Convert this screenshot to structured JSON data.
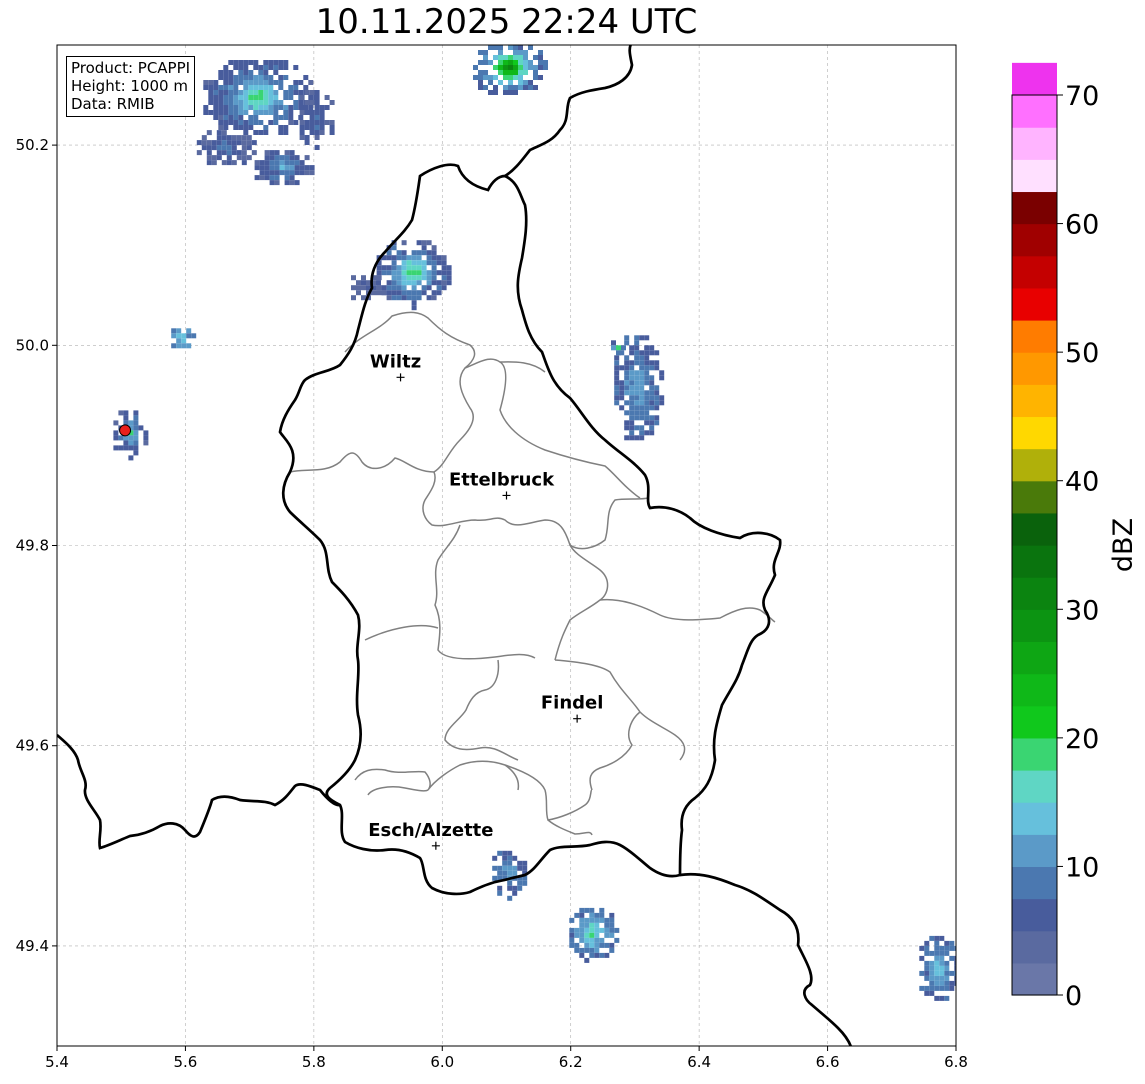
{
  "title": "10.11.2025 22:24 UTC",
  "info": {
    "product": "Product: PCAPPI",
    "height": "Height: 1000 m",
    "data": "Data: RMIB"
  },
  "axes": {
    "x_ticks": [
      "5.4",
      "5.6",
      "5.8",
      "6.0",
      "6.2",
      "6.4",
      "6.6",
      "6.8"
    ],
    "y_ticks": [
      "49.4",
      "49.6",
      "49.8",
      "50.0",
      "50.2"
    ],
    "xlim": [
      5.4,
      6.8
    ],
    "ylim": [
      49.3,
      50.3
    ],
    "grid": true
  },
  "cities": [
    {
      "name": "Wiltz",
      "lon": 5.935,
      "lat": 49.968
    },
    {
      "name": "Ettelbruck",
      "lon": 6.1,
      "lat": 49.85
    },
    {
      "name": "Findel",
      "lon": 6.21,
      "lat": 49.627
    },
    {
      "name": "Esch/Alzette",
      "lon": 5.99,
      "lat": 49.5
    }
  ],
  "radar_site": {
    "lon": 5.506,
    "lat": 49.915,
    "color": "#e8201c"
  },
  "colorbar": {
    "label": "dBZ",
    "ticks": [
      "0",
      "10",
      "20",
      "30",
      "40",
      "50",
      "60",
      "70"
    ],
    "min": 0,
    "max": 70,
    "step": 2.5,
    "colors": [
      "#6a77a8",
      "#5a6aa0",
      "#485c9c",
      "#4b78b0",
      "#5b9ac8",
      "#66c0dc",
      "#5fd6c4",
      "#3ad572",
      "#10c81c",
      "#0fb818",
      "#0ea614",
      "#0c9412",
      "#0b8410",
      "#0a740e",
      "#0a620c",
      "#4a7a0a",
      "#b0b00a",
      "#ffd800",
      "#ffb400",
      "#ff9800",
      "#ff7c00",
      "#e80000",
      "#c40000",
      "#a00000",
      "#7a0000",
      "#ffe0ff",
      "#ffb4ff",
      "#ff70ff",
      "#ee33ee"
    ]
  },
  "echoes": [
    {
      "lon": 5.71,
      "lat": 50.25,
      "w": 0.09,
      "h": 0.04,
      "dbz": 6,
      "core": 20
    },
    {
      "lon": 5.66,
      "lat": 50.2,
      "w": 0.05,
      "h": 0.02,
      "dbz": 5,
      "core": 8
    },
    {
      "lon": 5.75,
      "lat": 50.18,
      "w": 0.05,
      "h": 0.02,
      "dbz": 5,
      "core": 13
    },
    {
      "lon": 5.8,
      "lat": 50.23,
      "w": 0.03,
      "h": 0.03,
      "dbz": 5,
      "core": 8
    },
    {
      "lon": 6.1,
      "lat": 50.28,
      "w": 0.06,
      "h": 0.03,
      "dbz": 7,
      "core": 33
    },
    {
      "lon": 5.95,
      "lat": 50.075,
      "w": 0.06,
      "h": 0.035,
      "dbz": 6,
      "core": 22
    },
    {
      "lon": 5.88,
      "lat": 50.06,
      "w": 0.03,
      "h": 0.015,
      "dbz": 4,
      "core": 6
    },
    {
      "lon": 5.59,
      "lat": 50.01,
      "w": 0.02,
      "h": 0.012,
      "dbz": 10,
      "core": 16
    },
    {
      "lon": 5.51,
      "lat": 49.915,
      "w": 0.03,
      "h": 0.025,
      "dbz": 5,
      "core": 18
    },
    {
      "lon": 6.3,
      "lat": 49.96,
      "w": 0.04,
      "h": 0.055,
      "dbz": 7,
      "core": 13
    },
    {
      "lon": 6.27,
      "lat": 50.0,
      "w": 0.015,
      "h": 0.01,
      "dbz": 6,
      "core": 22
    },
    {
      "lon": 6.1,
      "lat": 49.475,
      "w": 0.03,
      "h": 0.025,
      "dbz": 7,
      "core": 13
    },
    {
      "lon": 6.23,
      "lat": 49.415,
      "w": 0.04,
      "h": 0.028,
      "dbz": 8,
      "core": 20
    },
    {
      "lon": 6.77,
      "lat": 49.38,
      "w": 0.035,
      "h": 0.035,
      "dbz": 7,
      "core": 16
    }
  ]
}
